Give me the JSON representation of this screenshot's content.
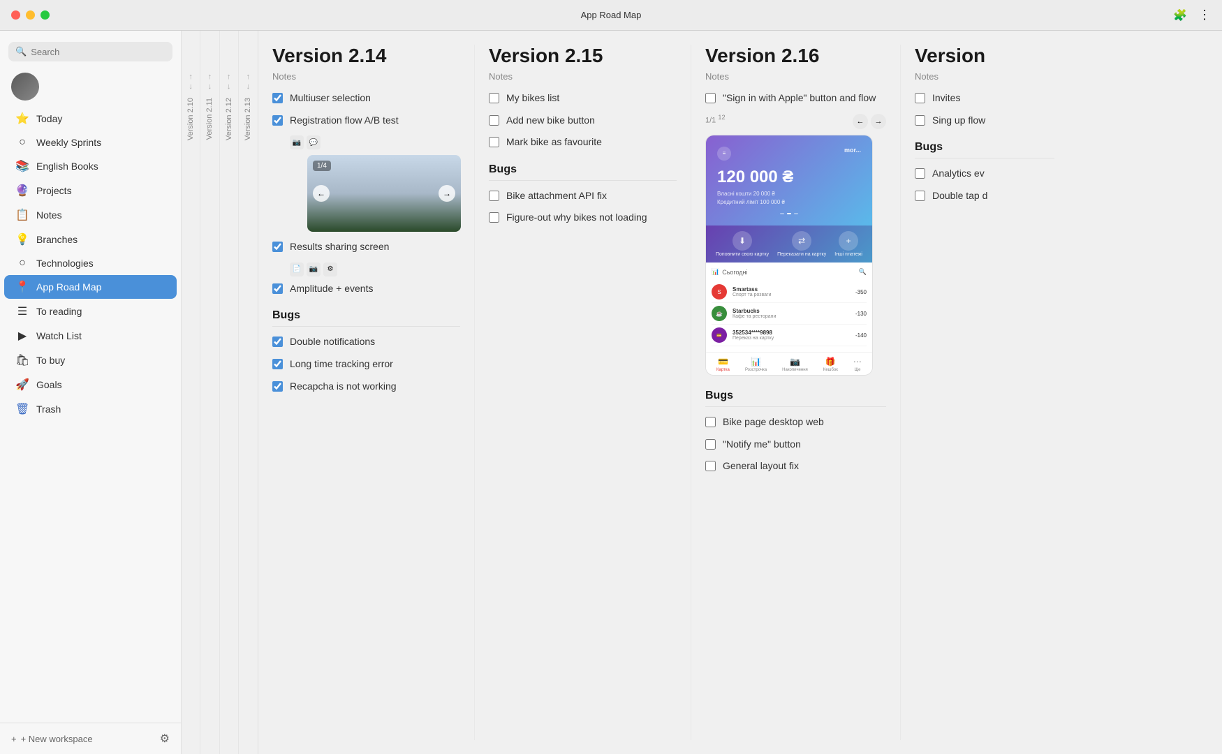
{
  "titlebar": {
    "title": "App Road Map",
    "buttons": {
      "close": "close",
      "minimize": "minimize",
      "maximize": "maximize"
    },
    "actions": {
      "extensions": "🧩",
      "menu": "⋮"
    }
  },
  "sidebar": {
    "search_placeholder": "Search",
    "nav_items": [
      {
        "id": "today",
        "label": "Today",
        "icon": "⭐",
        "active": false
      },
      {
        "id": "weekly-sprints",
        "label": "Weekly Sprints",
        "icon": "○",
        "active": false
      },
      {
        "id": "english-books",
        "label": "English Books",
        "icon": "📚",
        "active": false
      },
      {
        "id": "projects",
        "label": "Projects",
        "icon": "🔮",
        "active": false
      },
      {
        "id": "notes",
        "label": "Notes",
        "icon": "📋",
        "active": false
      },
      {
        "id": "branches",
        "label": "Branches",
        "icon": "💡",
        "active": false
      },
      {
        "id": "technologies",
        "label": "Technologies",
        "icon": "○",
        "active": false
      },
      {
        "id": "app-road-map",
        "label": "App Road Map",
        "icon": "📍",
        "active": true
      },
      {
        "id": "to-reading",
        "label": "To reading",
        "icon": "☰",
        "active": false
      },
      {
        "id": "watch-list",
        "label": "Watch List",
        "icon": "▶",
        "active": false
      },
      {
        "id": "to-buy",
        "label": "To buy",
        "icon": "🛍",
        "active": false
      },
      {
        "id": "goals",
        "label": "Goals",
        "icon": "🚀",
        "active": false
      },
      {
        "id": "trash",
        "label": "Trash",
        "icon": "🗑",
        "active": false
      }
    ],
    "footer": {
      "new_workspace": "+ New workspace",
      "settings_icon": "⚙"
    }
  },
  "vtabs": [
    {
      "label": "Version 2.10",
      "arrow_up": "↑",
      "arrow_down": "↓"
    },
    {
      "label": "Version 2.11",
      "arrow_up": "↑",
      "arrow_down": "↓"
    },
    {
      "label": "Version 2.12",
      "arrow_up": "↑",
      "arrow_down": "↓"
    },
    {
      "label": "Version 2.13",
      "arrow_up": "↑",
      "arrow_down": "↓"
    }
  ],
  "versions": [
    {
      "id": "v214",
      "title": "Version 2.14",
      "section_label": "Notes",
      "notes": [
        {
          "text": "Multiuser selection",
          "checked": true,
          "icons": []
        },
        {
          "text": "Registration flow A/B test",
          "checked": true,
          "icons": [
            "📷",
            "💬"
          ],
          "has_carousel": true,
          "carousel_count": "1/4"
        },
        {
          "text": "Results sharing screen",
          "checked": true,
          "icons": [
            "📄",
            "📷",
            "⚙"
          ]
        },
        {
          "text": "Amplitude + events",
          "checked": true,
          "icons": []
        }
      ],
      "bugs_label": "Bugs",
      "bugs": [
        {
          "text": "Double notifications",
          "checked": true
        },
        {
          "text": "Long time tracking error",
          "checked": true
        },
        {
          "text": "Recapcha is not working",
          "checked": true
        }
      ]
    },
    {
      "id": "v215",
      "title": "Version 2.15",
      "section_label": "Notes",
      "notes": [
        {
          "text": "My bikes list",
          "checked": false
        },
        {
          "text": "Add new bike button",
          "checked": false
        },
        {
          "text": "Mark bike as favourite",
          "checked": false
        }
      ],
      "bugs_label": "Bugs",
      "bugs": [
        {
          "text": "Bike attachment API fix",
          "checked": false
        },
        {
          "text": "Figure-out why bikes not loading",
          "checked": false
        }
      ]
    },
    {
      "id": "v216",
      "title": "Version 2.16",
      "section_label": "Notes",
      "notes": [
        {
          "text": "\"Sign in with Apple\" button and flow",
          "checked": false,
          "has_screenshot": true
        }
      ],
      "bugs_label": "Bugs",
      "bugs": [
        {
          "text": "Bike page desktop web",
          "checked": false
        },
        {
          "text": "\"Notify me\" button",
          "checked": false
        },
        {
          "text": "General layout fix",
          "checked": false
        }
      ],
      "screenshot": {
        "nav_arrows": [
          "←",
          "→"
        ],
        "nav_label": "1/1 12",
        "amount": "120 000 ₴",
        "details": [
          "Власні кошти   20 000 ₴",
          "Кредитний ліміт  100 000 ₴"
        ],
        "actions": [
          "Поповнити свою картку",
          "Переказати на картку",
          "Інші платежі"
        ],
        "action_icons": [
          "⬇",
          "⇄",
          "+"
        ],
        "list_header": "Сьогодні",
        "list_items": [
          {
            "name": "Smartass",
            "sub": "Спорт та розваги",
            "amount": "-350",
            "color": "#e53935"
          },
          {
            "name": "Starbucks",
            "sub": "Кафе та ресторани",
            "amount": "-130",
            "color": "#388e3c"
          },
          {
            "name": "352534****9898",
            "sub": "Переказ на картку",
            "amount": "-140",
            "color": "#7b1fa2"
          }
        ],
        "bottom_tabs": [
          "Картка",
          "Розстрочка",
          "Накопичення",
          "Кешбок",
          "Ще"
        ],
        "bottom_tab_icons": [
          "💳",
          "📊",
          "📷",
          "🎁",
          "⋯"
        ]
      }
    },
    {
      "id": "v217",
      "title": "Version",
      "section_label": "Notes",
      "notes": [
        {
          "text": "Invites",
          "checked": false
        },
        {
          "text": "Sing up flow",
          "checked": false
        }
      ],
      "bugs_label": "Bugs",
      "bugs": [
        {
          "text": "Analytics ev",
          "checked": false
        },
        {
          "text": "Double tap d",
          "checked": false
        }
      ]
    }
  ],
  "colors": {
    "accent": "#4a90d9",
    "sidebar_active_bg": "#4a90d9",
    "sidebar_bg": "#f7f7f7",
    "checkbox_checked": "#4a90d9",
    "trash_icon": "#3a6bc4"
  }
}
